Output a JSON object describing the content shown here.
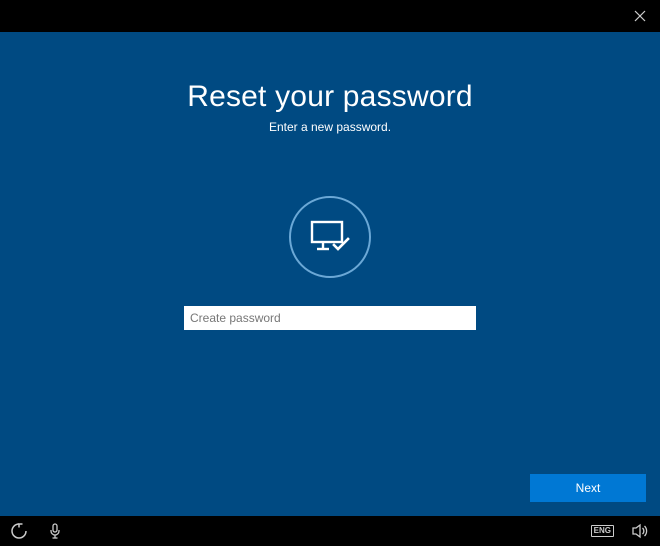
{
  "window": {
    "close_icon": "close"
  },
  "page": {
    "title": "Reset your password",
    "subtitle": "Enter a new password."
  },
  "form": {
    "password_placeholder": "Create password",
    "password_value": ""
  },
  "actions": {
    "next_label": "Next"
  },
  "taskbar": {
    "ease_of_access": "ease-of-access",
    "microphone": "microphone",
    "ime_label": "ENG",
    "volume": "volume"
  }
}
